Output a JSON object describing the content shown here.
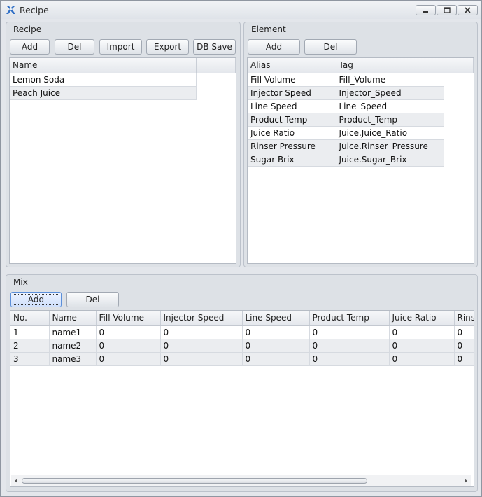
{
  "window": {
    "title": "Recipe",
    "accent": "#5b8fd9",
    "icons": {
      "app": "app-logo-icon",
      "minimize": "minimize-icon",
      "maximize": "maximize-icon",
      "close": "close-icon"
    }
  },
  "recipe": {
    "title": "Recipe",
    "buttons": {
      "add": "Add",
      "del": "Del",
      "import": "Import",
      "export": "Export",
      "db_save": "DB Save"
    },
    "columns": [
      "Name"
    ],
    "rows": [
      [
        "Lemon Soda"
      ],
      [
        "Peach Juice"
      ]
    ]
  },
  "element": {
    "title": "Element",
    "buttons": {
      "add": "Add",
      "del": "Del"
    },
    "columns": [
      "Alias",
      "Tag"
    ],
    "rows": [
      [
        "Fill Volume",
        "Fill_Volume"
      ],
      [
        "Injector Speed",
        "Injector_Speed"
      ],
      [
        "Line Speed",
        "Line_Speed"
      ],
      [
        "Product Temp",
        "Product_Temp"
      ],
      [
        "Juice Ratio",
        "Juice.Juice_Ratio"
      ],
      [
        "Rinser Pressure",
        "Juice.Rinser_Pressure"
      ],
      [
        "Sugar Brix",
        "Juice.Sugar_Brix"
      ]
    ]
  },
  "mix": {
    "title": "Mix",
    "buttons": {
      "add": "Add",
      "del": "Del"
    },
    "columns": [
      "No.",
      "Name",
      "Fill Volume",
      "Injector Speed",
      "Line Speed",
      "Product Temp",
      "Juice Ratio",
      "Rinser Pressure"
    ],
    "rows": [
      [
        "1",
        "name1",
        "0",
        "0",
        "0",
        "0",
        "0",
        "0"
      ],
      [
        "2",
        "name2",
        "0",
        "0",
        "0",
        "0",
        "0",
        "0"
      ],
      [
        "3",
        "name3",
        "0",
        "0",
        "0",
        "0",
        "0",
        "0"
      ]
    ],
    "scroll_icons": {
      "left": "scroll-left-arrow-icon",
      "right": "scroll-right-arrow-icon"
    }
  }
}
